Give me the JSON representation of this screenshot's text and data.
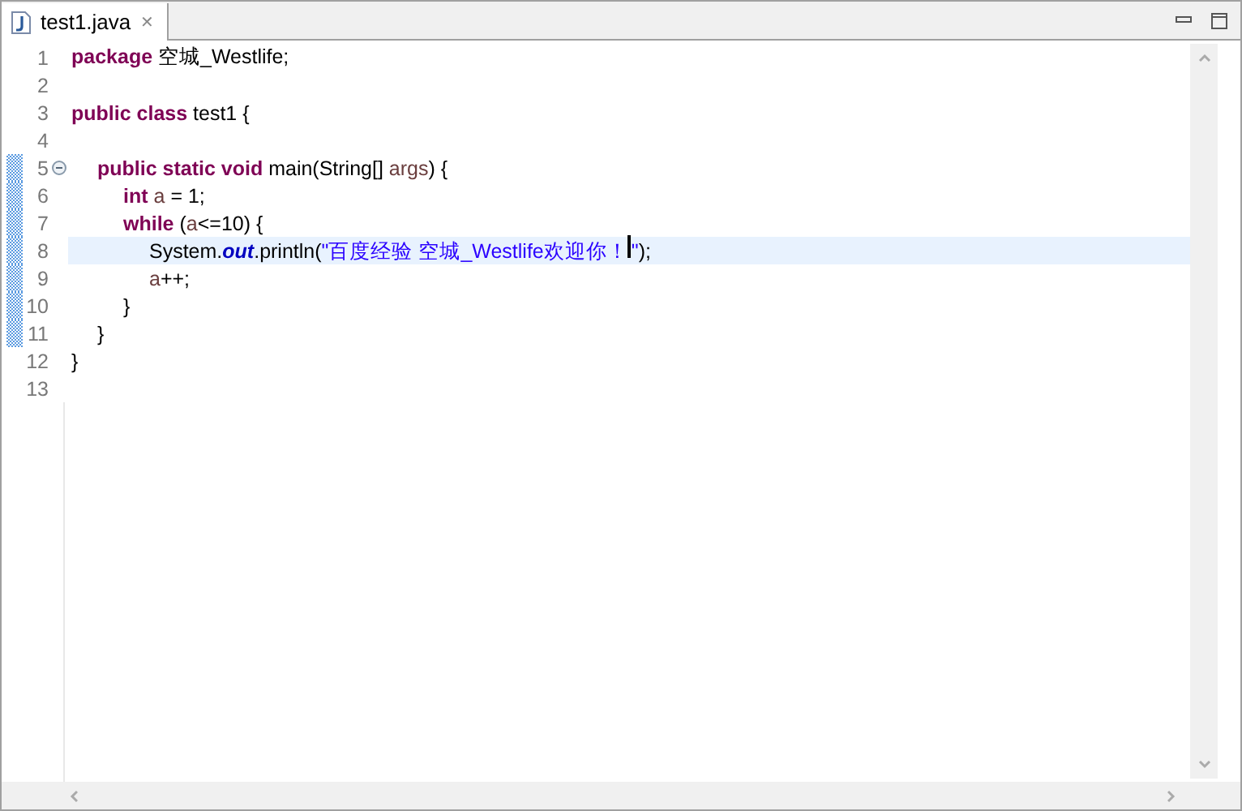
{
  "tab": {
    "title": "test1.java",
    "selected": true,
    "close": "✕"
  },
  "lines": [
    {
      "number": "1",
      "changed": false,
      "current": false,
      "tokens": [
        {
          "kind": "keyword",
          "text": "package"
        },
        {
          "kind": "plain",
          "text": " 空城_Westlife;"
        }
      ]
    },
    {
      "number": "2",
      "changed": false,
      "current": false
    },
    {
      "number": "3",
      "changed": false,
      "current": false,
      "tokens": [
        {
          "kind": "keyword",
          "text": "public class"
        },
        {
          "kind": "plain",
          "text": " test1 {"
        }
      ],
      "children": [
        {
          "number": "4",
          "changed": false,
          "current": false
        },
        {
          "number": "5",
          "changed": true,
          "current": false,
          "folded": false,
          "tokens": [
            {
              "kind": "keyword",
              "text": "public static void"
            },
            {
              "kind": "plain",
              "text": " main(String[] "
            },
            {
              "kind": "variable",
              "text": "args"
            },
            {
              "kind": "plain",
              "text": ") {"
            }
          ],
          "children": [
            {
              "number": "6",
              "changed": true,
              "current": false,
              "tokens": [
                {
                  "kind": "keyword",
                  "text": "int"
                },
                {
                  "kind": "variable",
                  "text": " a"
                },
                {
                  "kind": "plain",
                  "text": " = 1;"
                }
              ]
            },
            {
              "number": "7",
              "changed": true,
              "current": false,
              "tokens": [
                {
                  "kind": "keyword",
                  "text": "while"
                },
                {
                  "kind": "plain",
                  "text": " ("
                },
                {
                  "kind": "variable",
                  "text": "a"
                },
                {
                  "kind": "plain",
                  "text": "<=10) {"
                }
              ],
              "children": [
                {
                  "number": "8",
                  "changed": true,
                  "current": true,
                  "tokens": [
                    {
                      "kind": "plain",
                      "text": "System."
                    },
                    {
                      "kind": "field",
                      "text": "out"
                    },
                    {
                      "kind": "plain",
                      "text": ".println("
                    },
                    {
                      "kind": "string",
                      "text": "\"百度经验 空城_Westlife欢迎你！"
                    },
                    {
                      "kind": "caret"
                    },
                    {
                      "kind": "string",
                      "text": "\""
                    },
                    {
                      "kind": "plain",
                      "text": ");"
                    }
                  ]
                },
                {
                  "number": "9",
                  "changed": true,
                  "current": false,
                  "tokens": [
                    {
                      "kind": "variable",
                      "text": "a"
                    },
                    {
                      "kind": "plain",
                      "text": "++;"
                    }
                  ]
                }
              ]
            },
            {
              "number": "10",
              "changed": true,
              "current": false,
              "tokens": [
                {
                  "kind": "plain",
                  "text": "}"
                }
              ]
            }
          ]
        },
        {
          "number": "11",
          "changed": true,
          "current": false,
          "tokens": [
            {
              "kind": "plain",
              "text": "}"
            }
          ]
        }
      ]
    },
    {
      "number": "12",
      "changed": false,
      "current": false,
      "tokens": [
        {
          "kind": "plain",
          "text": "}"
        }
      ]
    },
    {
      "number": "13",
      "changed": false,
      "current": false
    }
  ]
}
